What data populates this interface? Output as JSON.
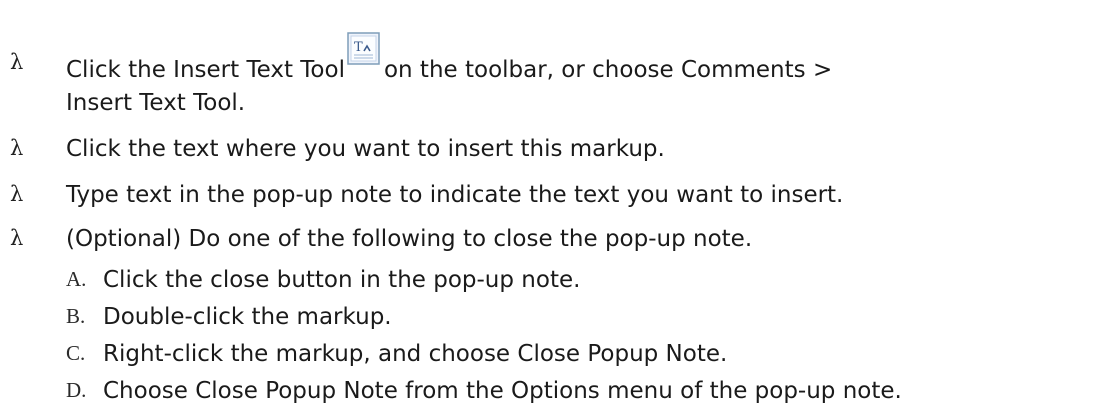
{
  "steps": [
    {
      "bullet": "λ",
      "text_before_icon": "Click the Insert Text Tool",
      "icon": "insert-text-tool-icon",
      "text_after_icon": "on the toolbar, or choose Comments >",
      "continuation": "Insert Text Tool."
    },
    {
      "bullet": "λ",
      "text": "Click the text where you want to insert this markup."
    },
    {
      "bullet": "λ",
      "text": "Type text in the pop-up note to indicate the text you want to insert."
    },
    {
      "bullet": "λ",
      "text": "(Optional) Do one of the following to close the pop-up note."
    }
  ],
  "options": [
    {
      "letter": "A.",
      "text": "Click the close button in the pop-up note."
    },
    {
      "letter": "B.",
      "text": "Double-click the markup."
    },
    {
      "letter": "C.",
      "text": "Right-click the markup, and choose Close Popup Note."
    },
    {
      "letter": "D.",
      "text": "Choose Close Popup Note from the Options menu of the pop-up note."
    }
  ],
  "colors": {
    "icon_border": "#7f9db9",
    "icon_fill": "#eef3fb",
    "icon_glyph": "#3a5a8c"
  }
}
